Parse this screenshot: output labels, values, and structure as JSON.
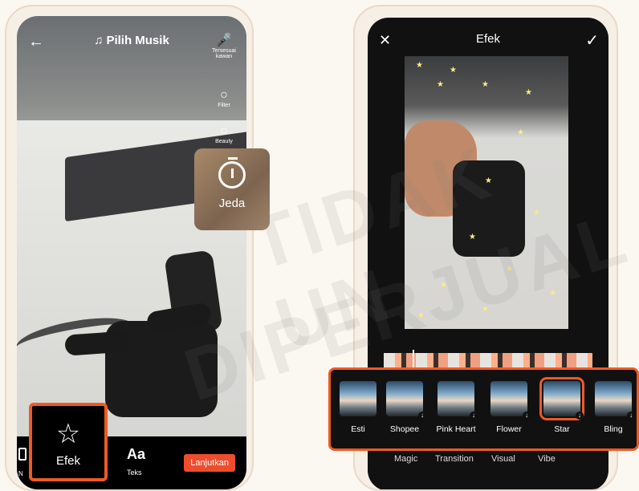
{
  "left_screen": {
    "title": "Pilih Musik",
    "side_tools": [
      {
        "icon": "microphone-icon",
        "label": "Tersesuai kawan"
      },
      {
        "icon": "filter-icon",
        "label": "Filter"
      },
      {
        "icon": "beauty-icon",
        "label": "Beauty"
      }
    ],
    "pause_label": "Jeda",
    "bottom": {
      "efek_label": "Efek",
      "teks_icon": "Aa",
      "teks_label": "Teks",
      "next_label": "Lanjutkan",
      "nav_label": "N"
    }
  },
  "right_screen": {
    "title": "Efek",
    "effects": [
      {
        "name": "Esti",
        "downloadable": false
      },
      {
        "name": "Shopee",
        "downloadable": true
      },
      {
        "name": "Pink Heart",
        "downloadable": true
      },
      {
        "name": "Flower",
        "downloadable": true
      },
      {
        "name": "Star",
        "downloadable": true,
        "selected": true
      },
      {
        "name": "Bling",
        "downloadable": true
      }
    ],
    "categories": [
      "Magic",
      "Transition",
      "Visual",
      "Vibe"
    ]
  },
  "colors": {
    "accent": "#ee5a24",
    "button": "#ee4d2d"
  },
  "watermark": [
    "TIDAK UN",
    "DIPERJUAL"
  ]
}
